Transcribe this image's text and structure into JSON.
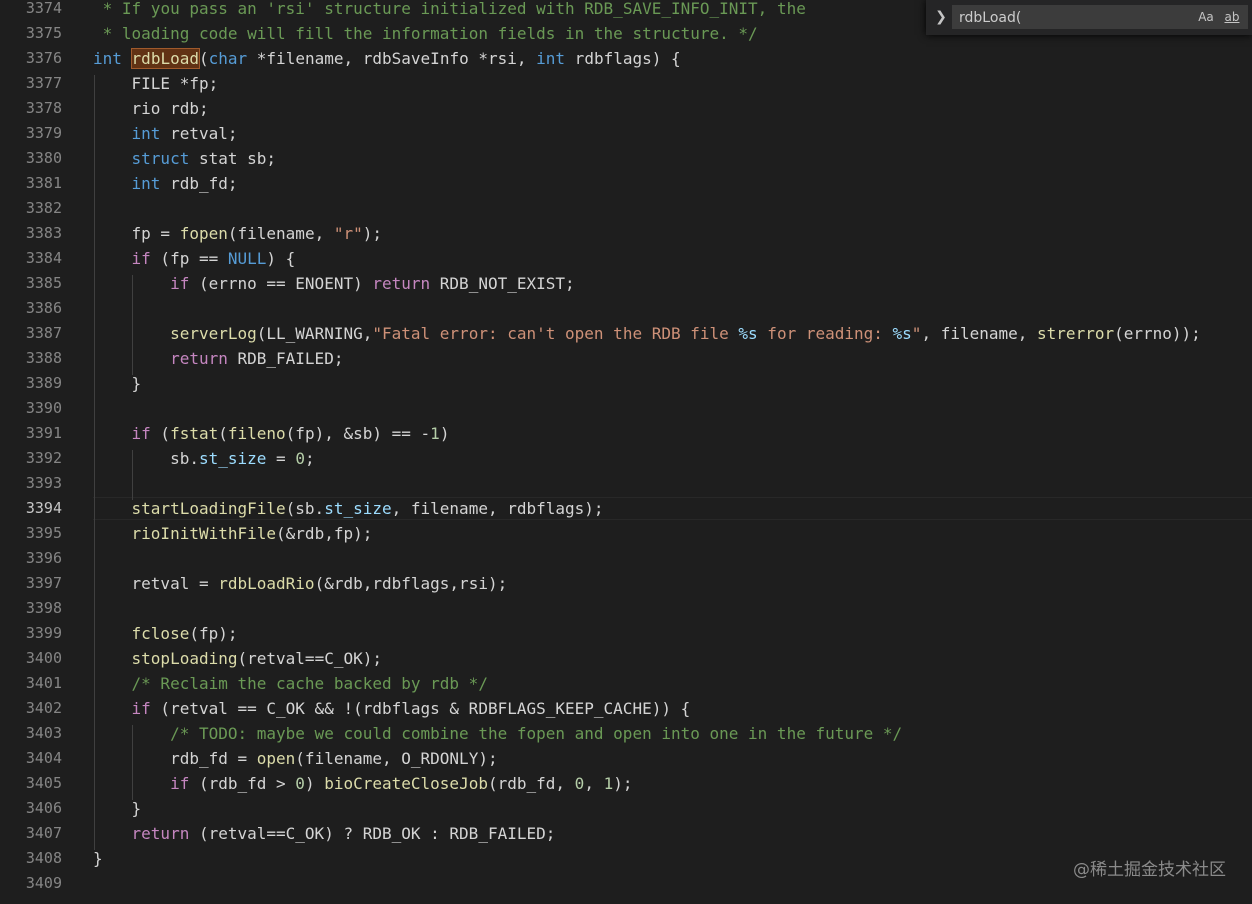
{
  "find_widget": {
    "query": "rdbLoad(",
    "match_case_label": "Aa",
    "whole_word_label": "ab",
    "regex_label": ".*"
  },
  "watermark": "@稀土掘金技术社区",
  "active_line": "3394",
  "lines": [
    {
      "n": "3374",
      "code": " * If you pass an 'rsi' structure initialized with RDB_SAVE_INFO_INIT, the"
    },
    {
      "n": "3375",
      "code": " * loading code will fill the information fields in the structure. */"
    },
    {
      "n": "3376",
      "code": "int rdbLoad(char *filename, rdbSaveInfo *rsi, int rdbflags) {"
    },
    {
      "n": "3377",
      "code": "    FILE *fp;"
    },
    {
      "n": "3378",
      "code": "    rio rdb;"
    },
    {
      "n": "3379",
      "code": "    int retval;"
    },
    {
      "n": "3380",
      "code": "    struct stat sb;"
    },
    {
      "n": "3381",
      "code": "    int rdb_fd;"
    },
    {
      "n": "3382",
      "code": ""
    },
    {
      "n": "3383",
      "code": "    fp = fopen(filename, \"r\");"
    },
    {
      "n": "3384",
      "code": "    if (fp == NULL) {"
    },
    {
      "n": "3385",
      "code": "        if (errno == ENOENT) return RDB_NOT_EXIST;"
    },
    {
      "n": "3386",
      "code": ""
    },
    {
      "n": "3387",
      "code": "        serverLog(LL_WARNING,\"Fatal error: can't open the RDB file %s for reading: %s\", filename, strerror(errno));"
    },
    {
      "n": "3388",
      "code": "        return RDB_FAILED;"
    },
    {
      "n": "3389",
      "code": "    }"
    },
    {
      "n": "3390",
      "code": ""
    },
    {
      "n": "3391",
      "code": "    if (fstat(fileno(fp), &sb) == -1)"
    },
    {
      "n": "3392",
      "code": "        sb.st_size = 0;"
    },
    {
      "n": "3393",
      "code": ""
    },
    {
      "n": "3394",
      "code": "    startLoadingFile(sb.st_size, filename, rdbflags);"
    },
    {
      "n": "3395",
      "code": "    rioInitWithFile(&rdb,fp);"
    },
    {
      "n": "3396",
      "code": ""
    },
    {
      "n": "3397",
      "code": "    retval = rdbLoadRio(&rdb,rdbflags,rsi);"
    },
    {
      "n": "3398",
      "code": ""
    },
    {
      "n": "3399",
      "code": "    fclose(fp);"
    },
    {
      "n": "3400",
      "code": "    stopLoading(retval==C_OK);"
    },
    {
      "n": "3401",
      "code": "    /* Reclaim the cache backed by rdb */"
    },
    {
      "n": "3402",
      "code": "    if (retval == C_OK && !(rdbflags & RDBFLAGS_KEEP_CACHE)) {"
    },
    {
      "n": "3403",
      "code": "        /* TODO: maybe we could combine the fopen and open into one in the future */"
    },
    {
      "n": "3404",
      "code": "        rdb_fd = open(filename, O_RDONLY);"
    },
    {
      "n": "3405",
      "code": "        if (rdb_fd > 0) bioCreateCloseJob(rdb_fd, 0, 1);"
    },
    {
      "n": "3406",
      "code": "    }"
    },
    {
      "n": "3407",
      "code": "    return (retval==C_OK) ? RDB_OK : RDB_FAILED;"
    },
    {
      "n": "3408",
      "code": "}"
    },
    {
      "n": "3409",
      "code": ""
    }
  ]
}
